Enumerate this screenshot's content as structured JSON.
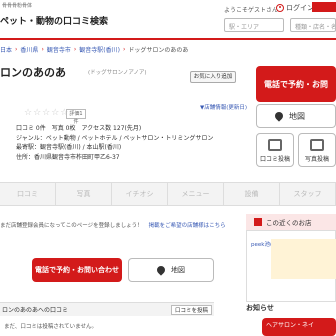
{
  "header": {
    "tiny_text": "骨骨骨粉骨体",
    "logo": "ペット・動物の口コミ検索",
    "welcome": "ようこそゲストさん",
    "login": "ログイン",
    "area_placeholder": "駅・エリア",
    "keyword_placeholder": "種類・店名・名"
  },
  "breadcrumb": [
    "日本",
    "香川県",
    "観音寺市",
    "観音寺駅(香川)",
    "ドッグサロンのあのあ"
  ],
  "shop": {
    "title": "ロンのあのあ",
    "kana": "(ドッグサロンノアノア)",
    "fav_button": "お気に入り追加",
    "stars": "☆☆☆☆☆",
    "eval": "評価1件",
    "latest": "▼店舗情報(更新日)",
    "info_lines": [
      "口コミ 0件　写真 0枚　アクセス数 127(先月)",
      "ジャンル：ペット動物 / ペットホテル / ペットサロン・トリミングサロン",
      "最寄駅：観音寺駅(香川) / 本山駅(香川)",
      "住所：香川県観音寺市柞田町甲乙6-37"
    ]
  },
  "actions": {
    "reserve": "電話で予約・お問",
    "map": "地図",
    "review": "口コミ投稿",
    "photo": "写真投稿",
    "reserve_small": "電話で予約・お問い合わせ",
    "map_small": "地図"
  },
  "tabs": [
    "口コミ",
    "写真",
    "イチオシ",
    "メニュー",
    "設備",
    "スタッフ"
  ],
  "notice": {
    "text": "まだ店舗登録会員になってこのページを登録しましょう！",
    "request": "掲載をご希望の店舗様はこちら"
  },
  "sidebar": {
    "near": "この近くのお店",
    "item": "peek池(ペ",
    "news": "お知らせ",
    "news_item": "ヘアサロン・ネイ"
  },
  "reviews": {
    "header": "ロンのあのあへの口コミ",
    "add": "口コミを投稿",
    "empty": "まだ、口コミは投稿されていません。"
  }
}
